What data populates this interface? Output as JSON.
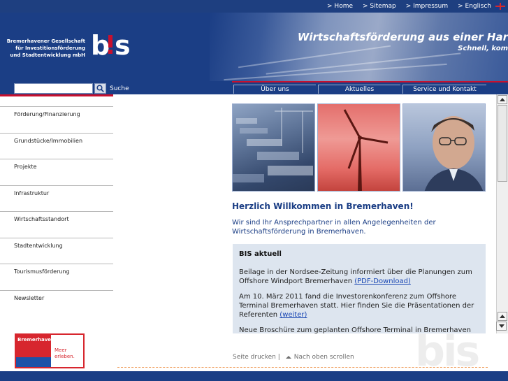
{
  "top_nav": {
    "links": [
      "> Home",
      "> Sitemap",
      "> Impressum",
      "> Englisch"
    ],
    "flag_icon": "uk-flag-icon"
  },
  "header": {
    "org_name_lines": [
      "Bremerhavener Gesellschaft",
      "für Investitionsförderung",
      "und Stadtentwicklung mbH"
    ],
    "logo_text": "bis",
    "headline": "Wirtschaftsförderung aus einer Har",
    "subline": "Schnell, kom"
  },
  "search": {
    "value": "",
    "button_icon": "search-icon",
    "label": "Suche"
  },
  "main_nav": {
    "tabs": [
      "Über uns",
      "Aktuelles",
      "Service und Kontakt"
    ]
  },
  "sidebar": {
    "items": [
      "Förderung/Finanzierung",
      "Grundstücke/Immobilien",
      "Projekte",
      "Infrastruktur",
      "Wirtschaftsstandort",
      "Stadtentwicklung",
      "Tourismusförderung",
      "Newsletter"
    ],
    "partner_logo": {
      "title": "Bremerhaven",
      "slogan_line1": "Meer",
      "slogan_line2": "erleben."
    }
  },
  "content": {
    "welcome_title": "Herzlich Willkommen in Bremerhaven!",
    "intro": "Wir sind Ihr Ansprechpartner in allen Angelegenheiten der Wirtschaftsförderung in Bremerhaven.",
    "news_box": {
      "title": "BIS aktuell",
      "items": [
        {
          "text": "Beilage in der Nordsee-Zeitung informiert über die Planungen zum Offshore Windport Bremerhaven ",
          "link": "(PDF-Download)"
        },
        {
          "text": "Am 10. März 2011 fand die Investorenkonferenz zum Offshore Terminal Bremerhaven statt. Hier finden Sie die Präsentationen der Referenten ",
          "link": "(weiter)"
        },
        {
          "text": "Neue Broschüre zum geplanten Offshore Terminal in Bremerhaven",
          "link": ""
        }
      ]
    }
  },
  "footer": {
    "print_label": "Seite drucken |",
    "scroll_icon": "arrow-up-icon",
    "scroll_label": "Nach oben scrollen",
    "watermark": "bis"
  },
  "colors": {
    "brand_blue": "#1b3e85",
    "accent_red": "#c8102e",
    "link_blue": "#1a47b3",
    "news_bg": "#dde5ef"
  }
}
